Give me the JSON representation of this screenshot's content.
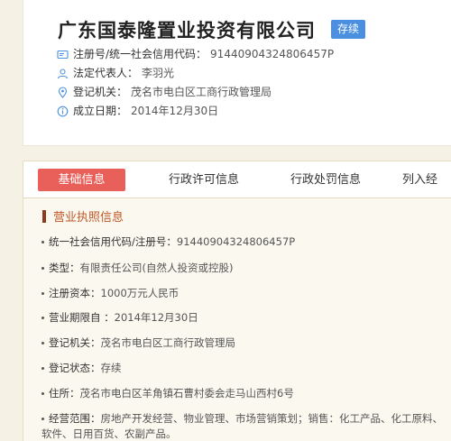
{
  "company": {
    "name": "广东国泰隆置业投资有限公司",
    "status": "存续",
    "info": [
      {
        "icon": "id-card-icon",
        "label": "注册号/统一社会信用代码：",
        "value": "91440904324806457P"
      },
      {
        "icon": "person-icon",
        "label": "法定代表人：",
        "value": "李羽光"
      },
      {
        "icon": "location-pin-icon",
        "label": "登记机关：",
        "value": "茂名市电白区工商行政管理局"
      },
      {
        "icon": "info-circle-icon",
        "label": "成立日期：",
        "value": "2014年12月30日"
      }
    ]
  },
  "tabs": [
    {
      "label": "基础信息",
      "active": true
    },
    {
      "label": "行政许可信息",
      "active": false
    },
    {
      "label": "行政处罚信息",
      "active": false
    },
    {
      "label": "列入经",
      "active": false
    }
  ],
  "section": {
    "title": "营业执照信息"
  },
  "details": [
    {
      "label": "统一社会信用代码/注册号：",
      "value": "91440904324806457P"
    },
    {
      "label": "类型：",
      "value": "有限责任公司(自然人投资或控股)"
    },
    {
      "label": "注册资本：",
      "value": "1000万元人民币"
    },
    {
      "label": "营业期限自 ：",
      "value": "2014年12月30日"
    },
    {
      "label": "登记机关：",
      "value": "茂名市电白区工商行政管理局"
    },
    {
      "label": "登记状态：",
      "value": "存续"
    },
    {
      "label": "住所：",
      "value": "茂名市电白区羊角镇石曹村委会走马山西村6号"
    },
    {
      "label": "经营范围：",
      "value": "房地产开发经营、物业管理、市场营销策划；销售：化工产品、化工原料、",
      "value2": "软件、日用百货、农副产品。"
    }
  ],
  "colors": {
    "accent": "#e9605b",
    "badge": "#4a8fe0",
    "section": "#c0572a",
    "icon": "#4a8fe0"
  }
}
